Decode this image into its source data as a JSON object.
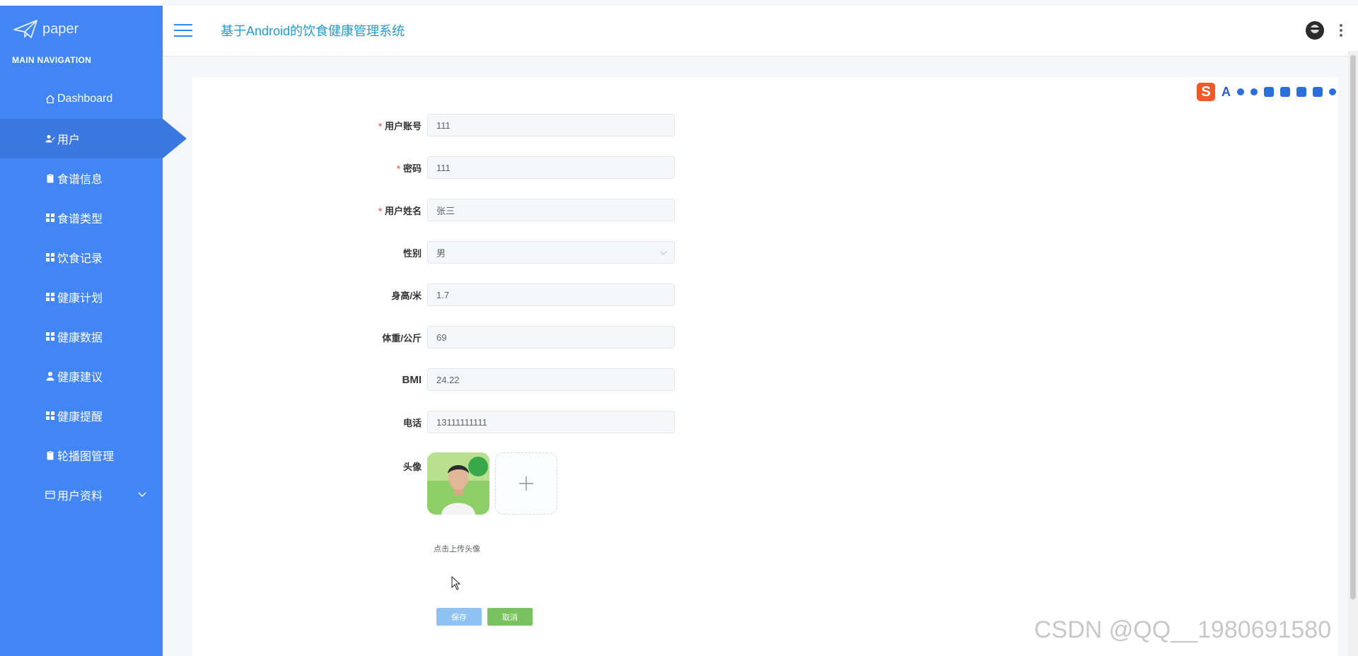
{
  "sidebar": {
    "logo_text": "paper",
    "nav_heading": "MAIN NAVIGATION",
    "items": [
      {
        "label": "Dashboard",
        "icon": "home-icon"
      },
      {
        "label": "用户",
        "icon": "user-edit-icon",
        "active": true
      },
      {
        "label": "食谱信息",
        "icon": "clipboard-icon"
      },
      {
        "label": "食谱类型",
        "icon": "grid-icon"
      },
      {
        "label": "饮食记录",
        "icon": "grid-icon"
      },
      {
        "label": "健康计划",
        "icon": "grid-icon"
      },
      {
        "label": "健康数据",
        "icon": "grid-icon"
      },
      {
        "label": "健康建议",
        "icon": "person-icon"
      },
      {
        "label": "健康提醒",
        "icon": "grid-icon"
      },
      {
        "label": "轮播图管理",
        "icon": "clipboard-icon"
      },
      {
        "label": "用户资料",
        "icon": "id-card-icon",
        "has_children": true
      }
    ]
  },
  "header": {
    "title": "基于Android的饮食健康管理系统"
  },
  "form": {
    "account": {
      "label": "用户账号",
      "required": true,
      "value": "111"
    },
    "password": {
      "label": "密码",
      "required": true,
      "value": "111"
    },
    "name": {
      "label": "用户姓名",
      "required": true,
      "value": "张三"
    },
    "gender": {
      "label": "性别",
      "value": "男"
    },
    "height": {
      "label": "身高/米",
      "value": "1.7"
    },
    "weight": {
      "label": "体重/公斤",
      "value": "69"
    },
    "bmi": {
      "label": "BMI",
      "value": "24.22"
    },
    "phone": {
      "label": "电话",
      "value": "13111111111"
    },
    "avatar": {
      "label": "头像",
      "tip": "点击上传头像"
    },
    "save_label": "保存",
    "cancel_label": "取消"
  },
  "watermark": "CSDN @QQ__1980691580",
  "colors": {
    "sidebar_bg": "#4285f4",
    "active_item": "#3a78e0",
    "title_text": "#1e9dcf",
    "save_button": "#8ec2f3",
    "cancel_button": "#79c35f",
    "required_star": "#f56c6c"
  }
}
